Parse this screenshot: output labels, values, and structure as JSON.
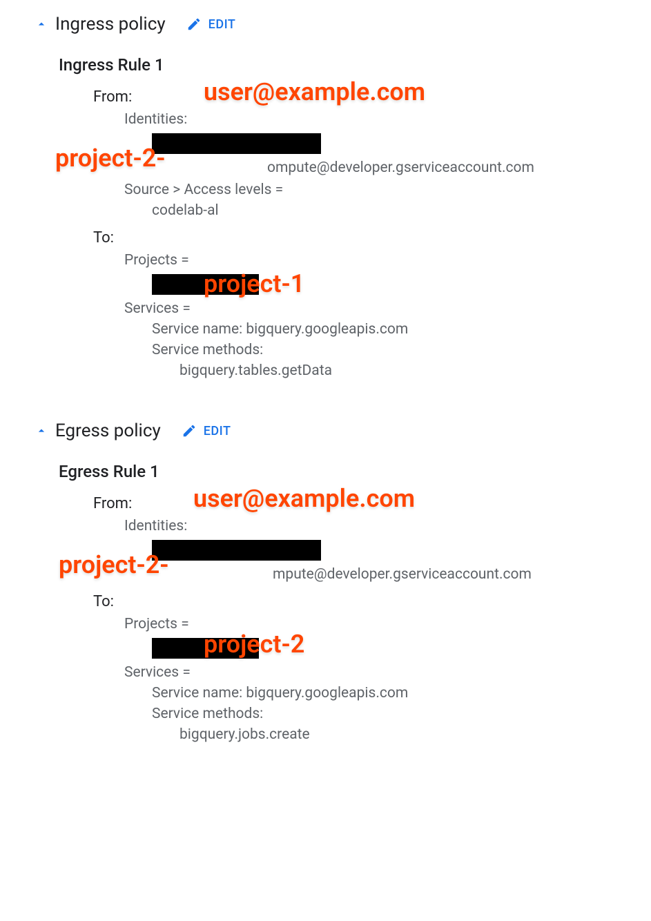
{
  "ingress": {
    "title": "Ingress policy",
    "edit": "EDIT",
    "rule_title": "Ingress Rule 1",
    "from_label": "From:",
    "identities_label": "Identities:",
    "sa_suffix": "ompute@developer.gserviceaccount.com",
    "source_levels": "Source > Access levels =",
    "access_level": "codelab-al",
    "to_label": "To:",
    "projects_label": "Projects =",
    "services_label": "Services =",
    "service_name": "Service name: bigquery.googleapis.com",
    "service_methods_label": "Service methods:",
    "service_method": "bigquery.tables.getData",
    "annotations": {
      "user_email": "user@example.com",
      "project2": "project-2-",
      "project1": "project-1"
    }
  },
  "egress": {
    "title": "Egress policy",
    "edit": "EDIT",
    "rule_title": "Egress Rule 1",
    "from_label": "From:",
    "identities_label": "Identities:",
    "sa_suffix": "mpute@developer.gserviceaccount.com",
    "to_label": "To:",
    "projects_label": "Projects =",
    "services_label": "Services =",
    "service_name": "Service name: bigquery.googleapis.com",
    "service_methods_label": "Service methods:",
    "service_method": "bigquery.jobs.create",
    "annotations": {
      "user_email": "user@example.com",
      "project2_from": "project-2-",
      "project2_to": "project-2"
    }
  }
}
